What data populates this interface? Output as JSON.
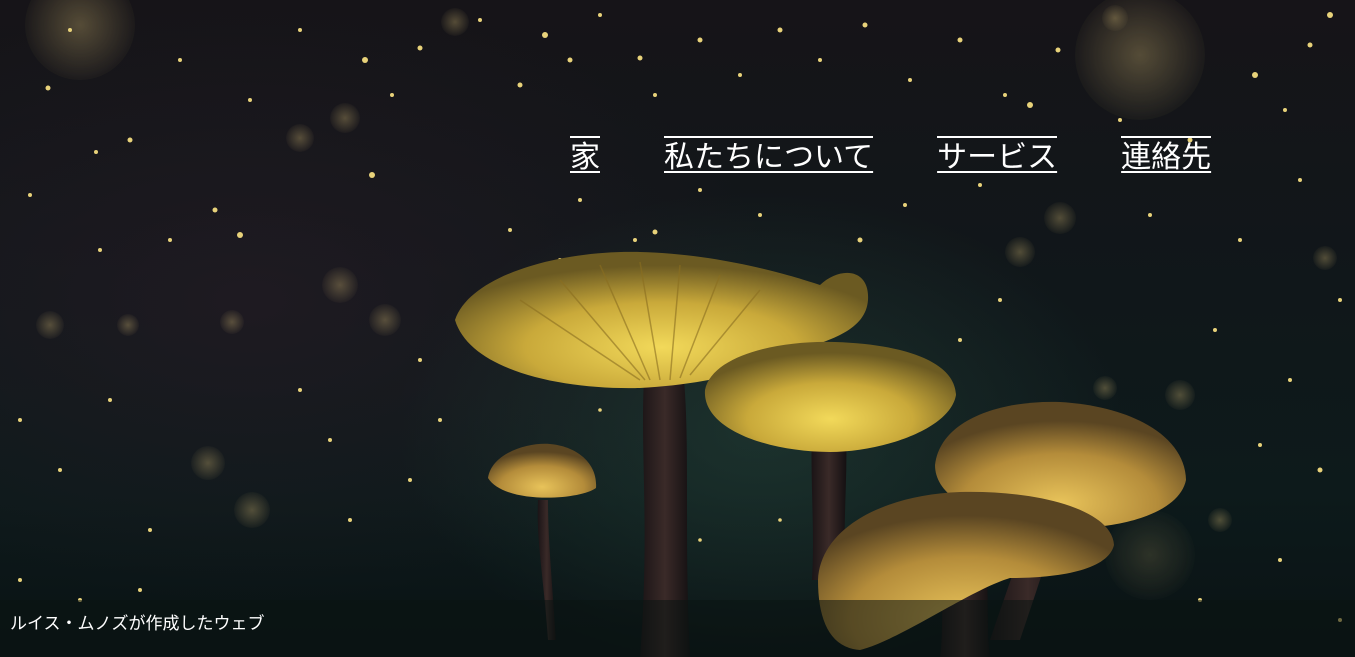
{
  "nav": {
    "items": [
      {
        "label": "家"
      },
      {
        "label": "私たちについて"
      },
      {
        "label": "サービス"
      },
      {
        "label": "連絡先"
      }
    ]
  },
  "footer": {
    "credit": "ルイス・ムノズが作成したウェブ"
  },
  "colors": {
    "text": "#ffffff",
    "background": "#0d1a1b",
    "mushroom_cap": "#c9a93a",
    "sparkle": "#e8d27a"
  },
  "hero_image": {
    "icon": "glowing-mushrooms-illustration"
  }
}
